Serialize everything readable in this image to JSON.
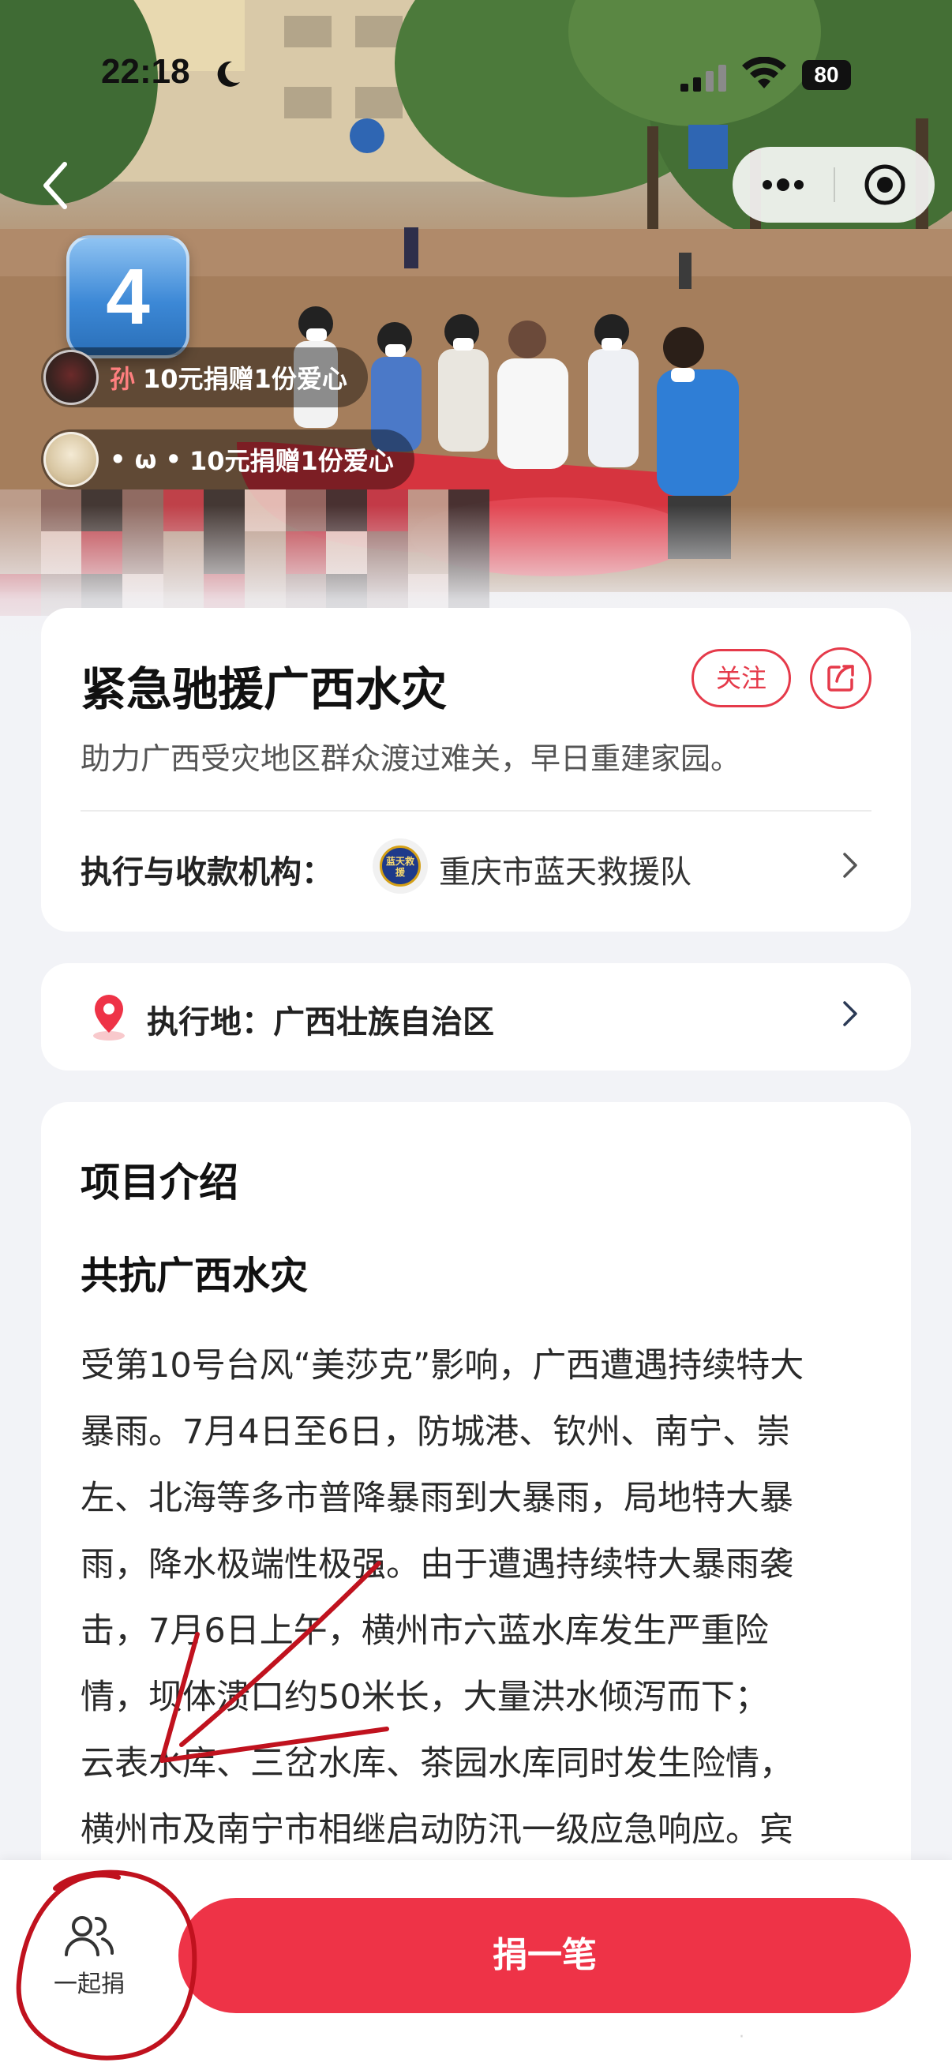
{
  "status_bar": {
    "time": "22:18",
    "battery": "80"
  },
  "hero": {
    "rank_badge": "4",
    "donations": [
      {
        "name": "孙",
        "message": "10元捐赠1份爱心"
      },
      {
        "name": "• ω •",
        "message": "10元捐赠1份爱心"
      }
    ]
  },
  "project": {
    "title": "紧急驰援广西水灾",
    "follow_label": "关注",
    "subtitle": "助力广西受灾地区群众渡过难关，早日重建家园。",
    "org_label": "执行与收款机构：",
    "org_logo_text": "蓝天救援",
    "org_name": "重庆市蓝天救援队"
  },
  "location": {
    "label": "执行地：广西壮族自治区"
  },
  "intro": {
    "heading": "项目介绍",
    "subheading": "共抗广西水灾",
    "lines": [
      "受第10号台风“美莎克”影响，广西遭遇持续特大",
      "暴雨。7月4日至6日，防城港、钦州、南宁、崇",
      "左、北海等多市普降暴雨到大暴雨，局地特大暴",
      "雨，降水极端性极强。由于遭遇持续特大暴雨袭",
      "击，7月6日上午，横州市六蓝水库发生严重险",
      "情，坝体溃口约50米长，大量洪水倾泻而下；",
      "云表水库、三岔水库、茶园水库同时发生险情，",
      "横州市及南宁市相继启动防汛一级应急响应。宾"
    ]
  },
  "bottom": {
    "together_label": "一起捐",
    "donate_label": "捐一笔"
  },
  "colors": {
    "accent": "#ee3347",
    "background": "#f2f3f7",
    "annotation": "#c0121e"
  }
}
